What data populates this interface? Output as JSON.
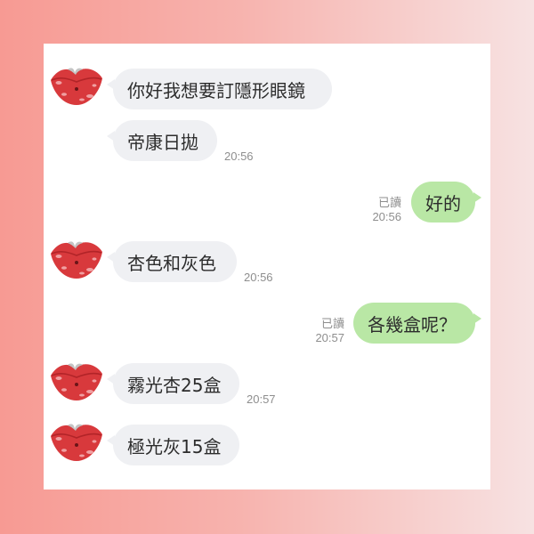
{
  "chat": {
    "messages": [
      {
        "side": "in",
        "text": "你好我想要訂隱形眼鏡",
        "time": ""
      },
      {
        "side": "in",
        "text": "帝康日拋",
        "time": "20:56"
      },
      {
        "side": "out",
        "text": "好的",
        "read": "已讀",
        "time": "20:56"
      },
      {
        "side": "in",
        "text": "杏色和灰色",
        "time": "20:56"
      },
      {
        "side": "out",
        "text": "各幾盒呢？",
        "read": "已讀",
        "time": "20:57"
      },
      {
        "side": "in",
        "text": "霧光杏25盒",
        "time": "20:57"
      },
      {
        "side": "in",
        "text": "極光灰15盒",
        "time": ""
      }
    ]
  },
  "colors": {
    "incoming_bubble": "#eff0f3",
    "outgoing_bubble": "#b9e7a5",
    "avatar_red": "#d8393c"
  }
}
